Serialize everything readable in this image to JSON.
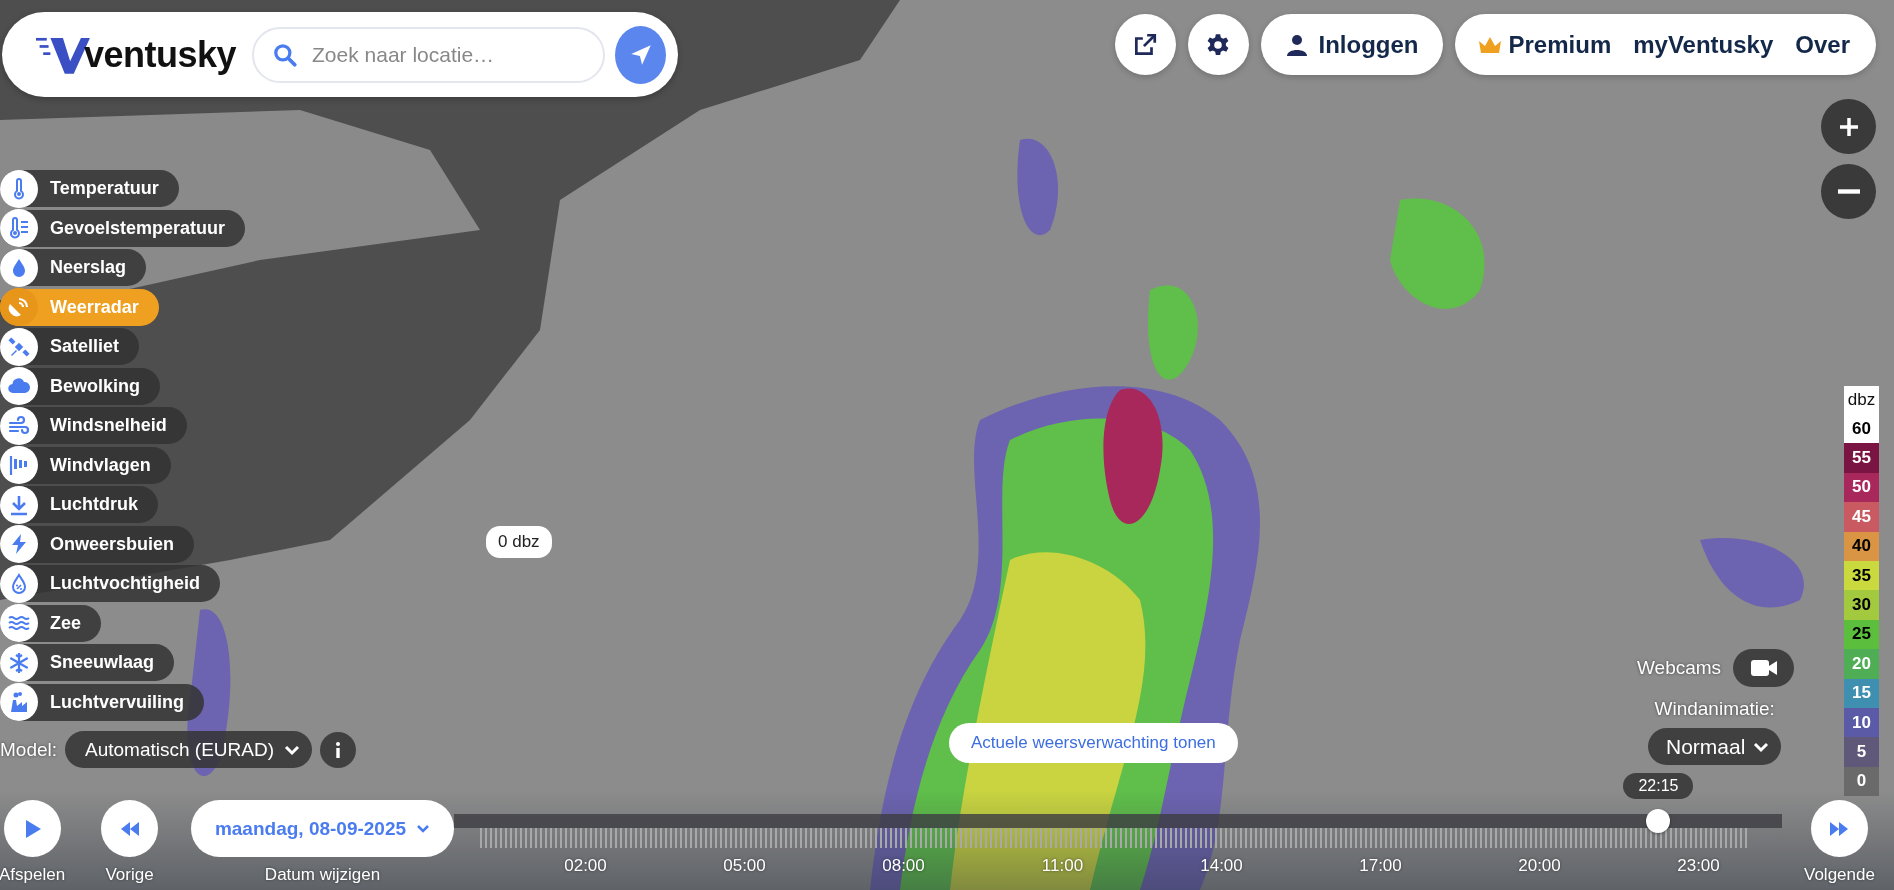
{
  "header": {
    "logo": "ventusky",
    "search": {
      "placeholder": "Zoek naar locatie…"
    }
  },
  "top_nav": {
    "login": "Inloggen",
    "links": [
      "Premium",
      "myVentusky",
      "Over"
    ]
  },
  "layers": [
    {
      "label": "Temperatuur",
      "selected": false
    },
    {
      "label": "Gevoelstemperatuur",
      "selected": false
    },
    {
      "label": "Neerslag",
      "selected": false
    },
    {
      "label": "Weerradar",
      "selected": true
    },
    {
      "label": "Satelliet",
      "selected": false
    },
    {
      "label": "Bewolking",
      "selected": false
    },
    {
      "label": "Windsnelheid",
      "selected": false
    },
    {
      "label": "Windvlagen",
      "selected": false
    },
    {
      "label": "Luchtdruk",
      "selected": false
    },
    {
      "label": "Onweersbuien",
      "selected": false
    },
    {
      "label": "Luchtvochtigheid",
      "selected": false
    },
    {
      "label": "Zee",
      "selected": false
    },
    {
      "label": "Sneeuwlaag",
      "selected": false
    },
    {
      "label": "Luchtvervuiling",
      "selected": false
    }
  ],
  "map": {
    "tooltip": "0 dbz",
    "forecast_button": "Actuele weersverwachting tonen"
  },
  "model": {
    "label": "Model:",
    "value": "Automatisch (EURAD)"
  },
  "legend": {
    "unit": "dbz",
    "steps": [
      {
        "value": "60",
        "color": "#ffffff"
      },
      {
        "value": "55",
        "color": "#7a1442"
      },
      {
        "value": "50",
        "color": "#a8285c"
      },
      {
        "value": "45",
        "color": "#c95a62"
      },
      {
        "value": "40",
        "color": "#d99444"
      },
      {
        "value": "35",
        "color": "#c9d93e"
      },
      {
        "value": "30",
        "color": "#a3c93f"
      },
      {
        "value": "25",
        "color": "#5bbf3d"
      },
      {
        "value": "20",
        "color": "#4fae55"
      },
      {
        "value": "15",
        "color": "#3f8fb0"
      },
      {
        "value": "10",
        "color": "#5a5aa6"
      },
      {
        "value": "5",
        "color": "#5f5878"
      },
      {
        "value": "0",
        "color": "#6a6a6a"
      }
    ]
  },
  "webcams": {
    "label": "Webcams",
    "on": false
  },
  "wind_animation": {
    "label": "Windanimatie:",
    "value": "Normaal"
  },
  "timeline": {
    "play": "Afspelen",
    "previous": "Vorige",
    "date": "maandag, 08-09-2025",
    "date_caption": "Datum wijzigen",
    "next": "Volgende",
    "current_time": "22:15",
    "level": 0.907,
    "ticks": [
      "02:00",
      "05:00",
      "08:00",
      "11:00",
      "14:00",
      "17:00",
      "20:00",
      "23:00"
    ]
  }
}
